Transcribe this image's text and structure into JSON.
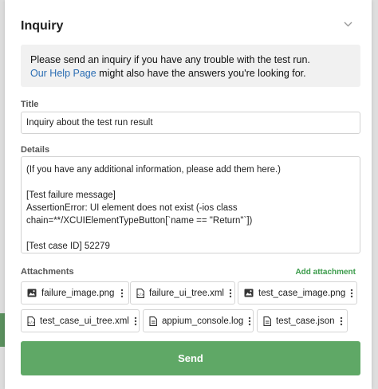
{
  "dialog": {
    "title": "Inquiry",
    "notice_line1": "Please send an inquiry if you have any trouble with the test run.",
    "notice_link": "Our Help Page",
    "notice_line2_rest": " might also have the answers you're looking for."
  },
  "form": {
    "title_label": "Title",
    "title_value": "Inquiry about the test run result",
    "details_label": "Details",
    "details_value": "(If you have any additional information, please add them here.)\n\n[Test failure message]\nAssertionError: UI element does not exist (-ios class chain=**/XCUIElementTypeButton[`name == \"Return\"`])\n\n[Test case ID] 52279"
  },
  "attachments": {
    "label": "Attachments",
    "add_label": "Add attachment",
    "files": [
      {
        "name": "failure_image.png",
        "icon": "image-icon"
      },
      {
        "name": "failure_ui_tree.xml",
        "icon": "code-file-icon"
      },
      {
        "name": "test_case_image.png",
        "icon": "image-icon"
      },
      {
        "name": "test_case_ui_tree.xml",
        "icon": "code-file-icon"
      },
      {
        "name": "appium_console.log",
        "icon": "text-file-icon"
      },
      {
        "name": "test_case.json",
        "icon": "text-file-icon"
      }
    ]
  },
  "actions": {
    "send_label": "Send"
  },
  "colors": {
    "accent_green": "#5fa866",
    "link_blue": "#2a6db3",
    "add_attachment_green": "#3b9b4a"
  }
}
